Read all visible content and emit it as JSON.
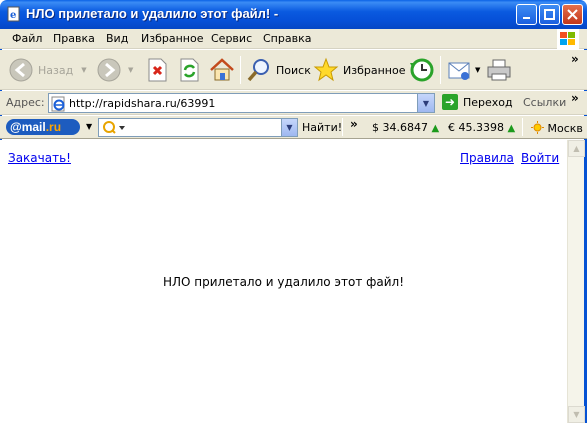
{
  "window": {
    "title": "НЛО прилетало и удалило этот файл! -",
    "minimize": "_",
    "maximize": "□",
    "close": "✕"
  },
  "menu": [
    "Файл",
    "Правка",
    "Вид",
    "Избранное",
    "Сервис",
    "Справка"
  ],
  "toolbar": {
    "back_label": "Назад",
    "search_label": "Поиск",
    "favorites_label": "Избранное"
  },
  "address": {
    "label": "Адрес:",
    "url": "http://rapidshara.ru/63991",
    "go_label": "Переход",
    "links_label": "Ссылки"
  },
  "mailru": {
    "logo_at": "@",
    "logo_mail": "mail",
    "logo_ru": ".ru",
    "find_label": "Найти!",
    "usd": "$ 34.6847",
    "eur": "€ 45.3398",
    "city": "Москв"
  },
  "page": {
    "download_link": "Закачать!",
    "rules_link": "Правила",
    "login_link": "Войти",
    "message": "НЛО прилетало и удалило этот файл!"
  },
  "icons": {
    "ie": "ie-page-icon",
    "windows_logo": "windows-flag-icon"
  }
}
